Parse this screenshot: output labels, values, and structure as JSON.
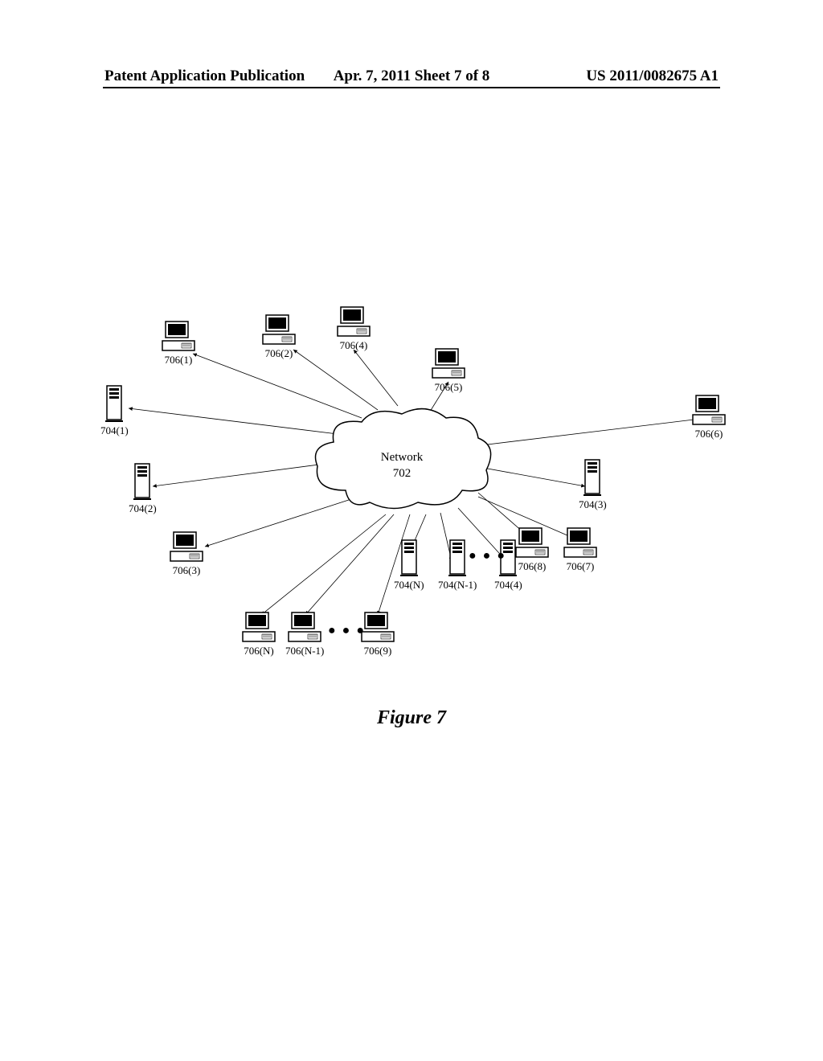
{
  "header": {
    "left": "Patent Application Publication",
    "center": "Apr. 7, 2011  Sheet 7 of 8",
    "right": "US 2011/0082675 A1"
  },
  "diagram": {
    "network_label": "Network",
    "network_ref": "702",
    "figure_label": "Figure 7",
    "nodes": {
      "c706_1": "706(1)",
      "c706_2": "706(2)",
      "c706_3": "706(3)",
      "c706_4": "706(4)",
      "c706_5": "706(5)",
      "c706_6": "706(6)",
      "c706_7": "706(7)",
      "c706_8": "706(8)",
      "c706_9": "706(9)",
      "c706_N1": "706(N-1)",
      "c706_N": "706(N)",
      "s704_1": "704(1)",
      "s704_2": "704(2)",
      "s704_3": "704(3)",
      "s704_4": "704(4)",
      "s704_N1": "704(N-1)",
      "s704_N": "704(N)"
    }
  }
}
